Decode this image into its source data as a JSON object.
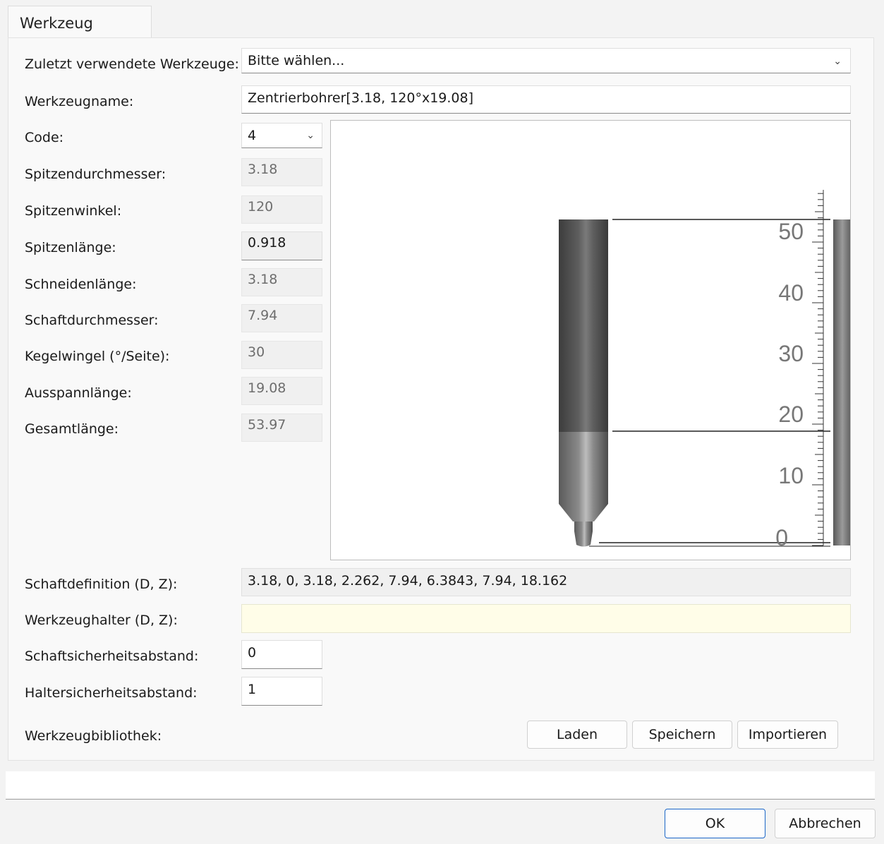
{
  "tab": {
    "label": "Werkzeug"
  },
  "recent_tools": {
    "label": "Zuletzt verwendete Werkzeuge:",
    "value": "Bitte wählen..."
  },
  "tool_name": {
    "label": "Werkzeugname:",
    "value": "Zentrierbohrer[3.18, 120°x19.08]"
  },
  "code": {
    "label": "Code:",
    "value": "4"
  },
  "params": [
    {
      "label": "Spitzendurchmesser:",
      "value": "3.18"
    },
    {
      "label": "Spitzenwinkel:",
      "value": "120"
    },
    {
      "label": "Spitzenlänge:",
      "value": "0.918"
    },
    {
      "label": "Schneidenlänge:",
      "value": "3.18"
    },
    {
      "label": "Schaftdurchmesser:",
      "value": "7.94"
    },
    {
      "label": "Kegelwingel (°/Seite):",
      "value": "30"
    },
    {
      "label": "Ausspannlänge:",
      "value": "19.08"
    },
    {
      "label": "Gesamtlänge:",
      "value": "53.97"
    }
  ],
  "preview": {
    "scale_labels": [
      "50",
      "40",
      "30",
      "20",
      "10",
      "0"
    ]
  },
  "shaft_def": {
    "label": "Schaftdefinition (D, Z):",
    "value": "3.18, 0, 3.18, 2.262, 7.94, 6.3843, 7.94, 18.162"
  },
  "holder": {
    "label": "Werkzeughalter (D, Z):",
    "value": ""
  },
  "shaft_clearance": {
    "label": "Schaftsicherheitsabstand:",
    "value": "0"
  },
  "holder_clearance": {
    "label": "Haltersicherheitsabstand:",
    "value": "1"
  },
  "library": {
    "label": "Werkzeugbibliothek:",
    "load": "Laden",
    "save": "Speichern",
    "import": "Importieren"
  },
  "footer": {
    "ok": "OK",
    "cancel": "Abbrechen"
  },
  "colors": {
    "accent": "#1a66c8",
    "holder_bg": "#fffde8"
  }
}
